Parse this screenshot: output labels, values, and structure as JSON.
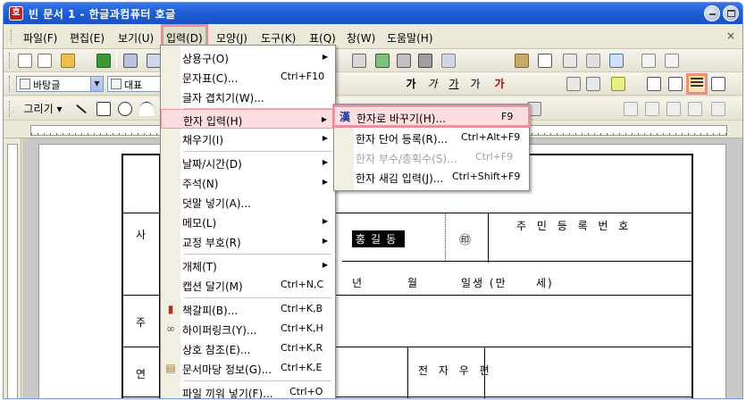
{
  "window": {
    "title": "빈 문서 1 - 한글과컴퓨터 호글",
    "app_icon": "호"
  },
  "menubar": {
    "items": [
      "파일(F)",
      "편집(E)",
      "보기(U)",
      "입력(D)",
      "모양(J)",
      "도구(K)",
      "표(Q)",
      "창(W)",
      "도움말(H)"
    ],
    "active": "입력(D)",
    "close_glyph": "×"
  },
  "toolbar2": {
    "style_dropdown": "바탕글",
    "font_dropdown": "대표",
    "format_buttons": [
      "가",
      "가",
      "가",
      "가",
      "가"
    ]
  },
  "toolbar3": {
    "draw_label": "그리기"
  },
  "input_menu": {
    "items": [
      {
        "label": "상용구(O)",
        "shortcut": "",
        "submenu": true,
        "icon": ""
      },
      {
        "label": "문자표(C)...",
        "shortcut": "Ctrl+F10",
        "submenu": false,
        "icon": ""
      },
      {
        "label": "글자 겹치기(W)...",
        "shortcut": "",
        "submenu": false,
        "icon": ""
      },
      {
        "label": "한자 입력(H)",
        "shortcut": "",
        "submenu": true,
        "icon": "",
        "highlighted": true
      },
      {
        "label": "채우기(I)",
        "shortcut": "",
        "submenu": true,
        "icon": ""
      },
      {
        "label": "날짜/시간(D)",
        "shortcut": "",
        "submenu": true,
        "icon": ""
      },
      {
        "label": "주석(N)",
        "shortcut": "",
        "submenu": true,
        "icon": ""
      },
      {
        "label": "덧말 넣기(A)...",
        "shortcut": "",
        "submenu": false,
        "icon": ""
      },
      {
        "label": "메모(L)",
        "shortcut": "",
        "submenu": true,
        "icon": ""
      },
      {
        "label": "교정 부호(R)",
        "shortcut": "",
        "submenu": true,
        "icon": ""
      },
      {
        "label": "개체(T)",
        "shortcut": "",
        "submenu": true,
        "icon": ""
      },
      {
        "label": "캡션 달기(M)",
        "shortcut": "Ctrl+N,C",
        "submenu": false,
        "icon": ""
      },
      {
        "label": "책갈피(B)...",
        "shortcut": "Ctrl+K,B",
        "submenu": false,
        "icon": "bookmark-icon"
      },
      {
        "label": "하이퍼링크(Y)...",
        "shortcut": "Ctrl+K,H",
        "submenu": false,
        "icon": "hyperlink-icon"
      },
      {
        "label": "상호 참조(E)...",
        "shortcut": "Ctrl+K,R",
        "submenu": false,
        "icon": ""
      },
      {
        "label": "문서마당 정보(G)...",
        "shortcut": "Ctrl+K,E",
        "submenu": false,
        "icon": "document-info-icon"
      },
      {
        "label": "파일 끼워 넣기(F)...",
        "shortcut": "Ctrl+O",
        "submenu": false,
        "icon": ""
      }
    ]
  },
  "hanja_submenu": {
    "items": [
      {
        "label": "한자로 바꾸기(H)...",
        "shortcut": "F9",
        "icon": "hanja-icon",
        "icon_glyph": "漢",
        "highlighted": true,
        "disabled": false
      },
      {
        "label": "한자 단어 등록(R)...",
        "shortcut": "Ctrl+Alt+F9",
        "disabled": false
      },
      {
        "label": "한자 부수/총획수(S)...",
        "shortcut": "Ctrl+F9",
        "disabled": true
      },
      {
        "label": "한자 새김 입력(J)...",
        "shortcut": "Ctrl+Shift+F9",
        "disabled": false
      }
    ]
  },
  "document": {
    "label_sa": "사",
    "label_ju": "주",
    "label_yeon": "연",
    "name": "홍길동",
    "seal": "㊞",
    "resident_number_label": "주 민 등 록 번 호",
    "birth_line": [
      "년",
      "월",
      "일생 (만",
      "세)"
    ],
    "email_label": "전 자 우 편"
  },
  "colors": {
    "titlebar": "#2060d8",
    "highlight_outline": "#ec8b9a",
    "menu_highlight": "#fbdde2"
  }
}
